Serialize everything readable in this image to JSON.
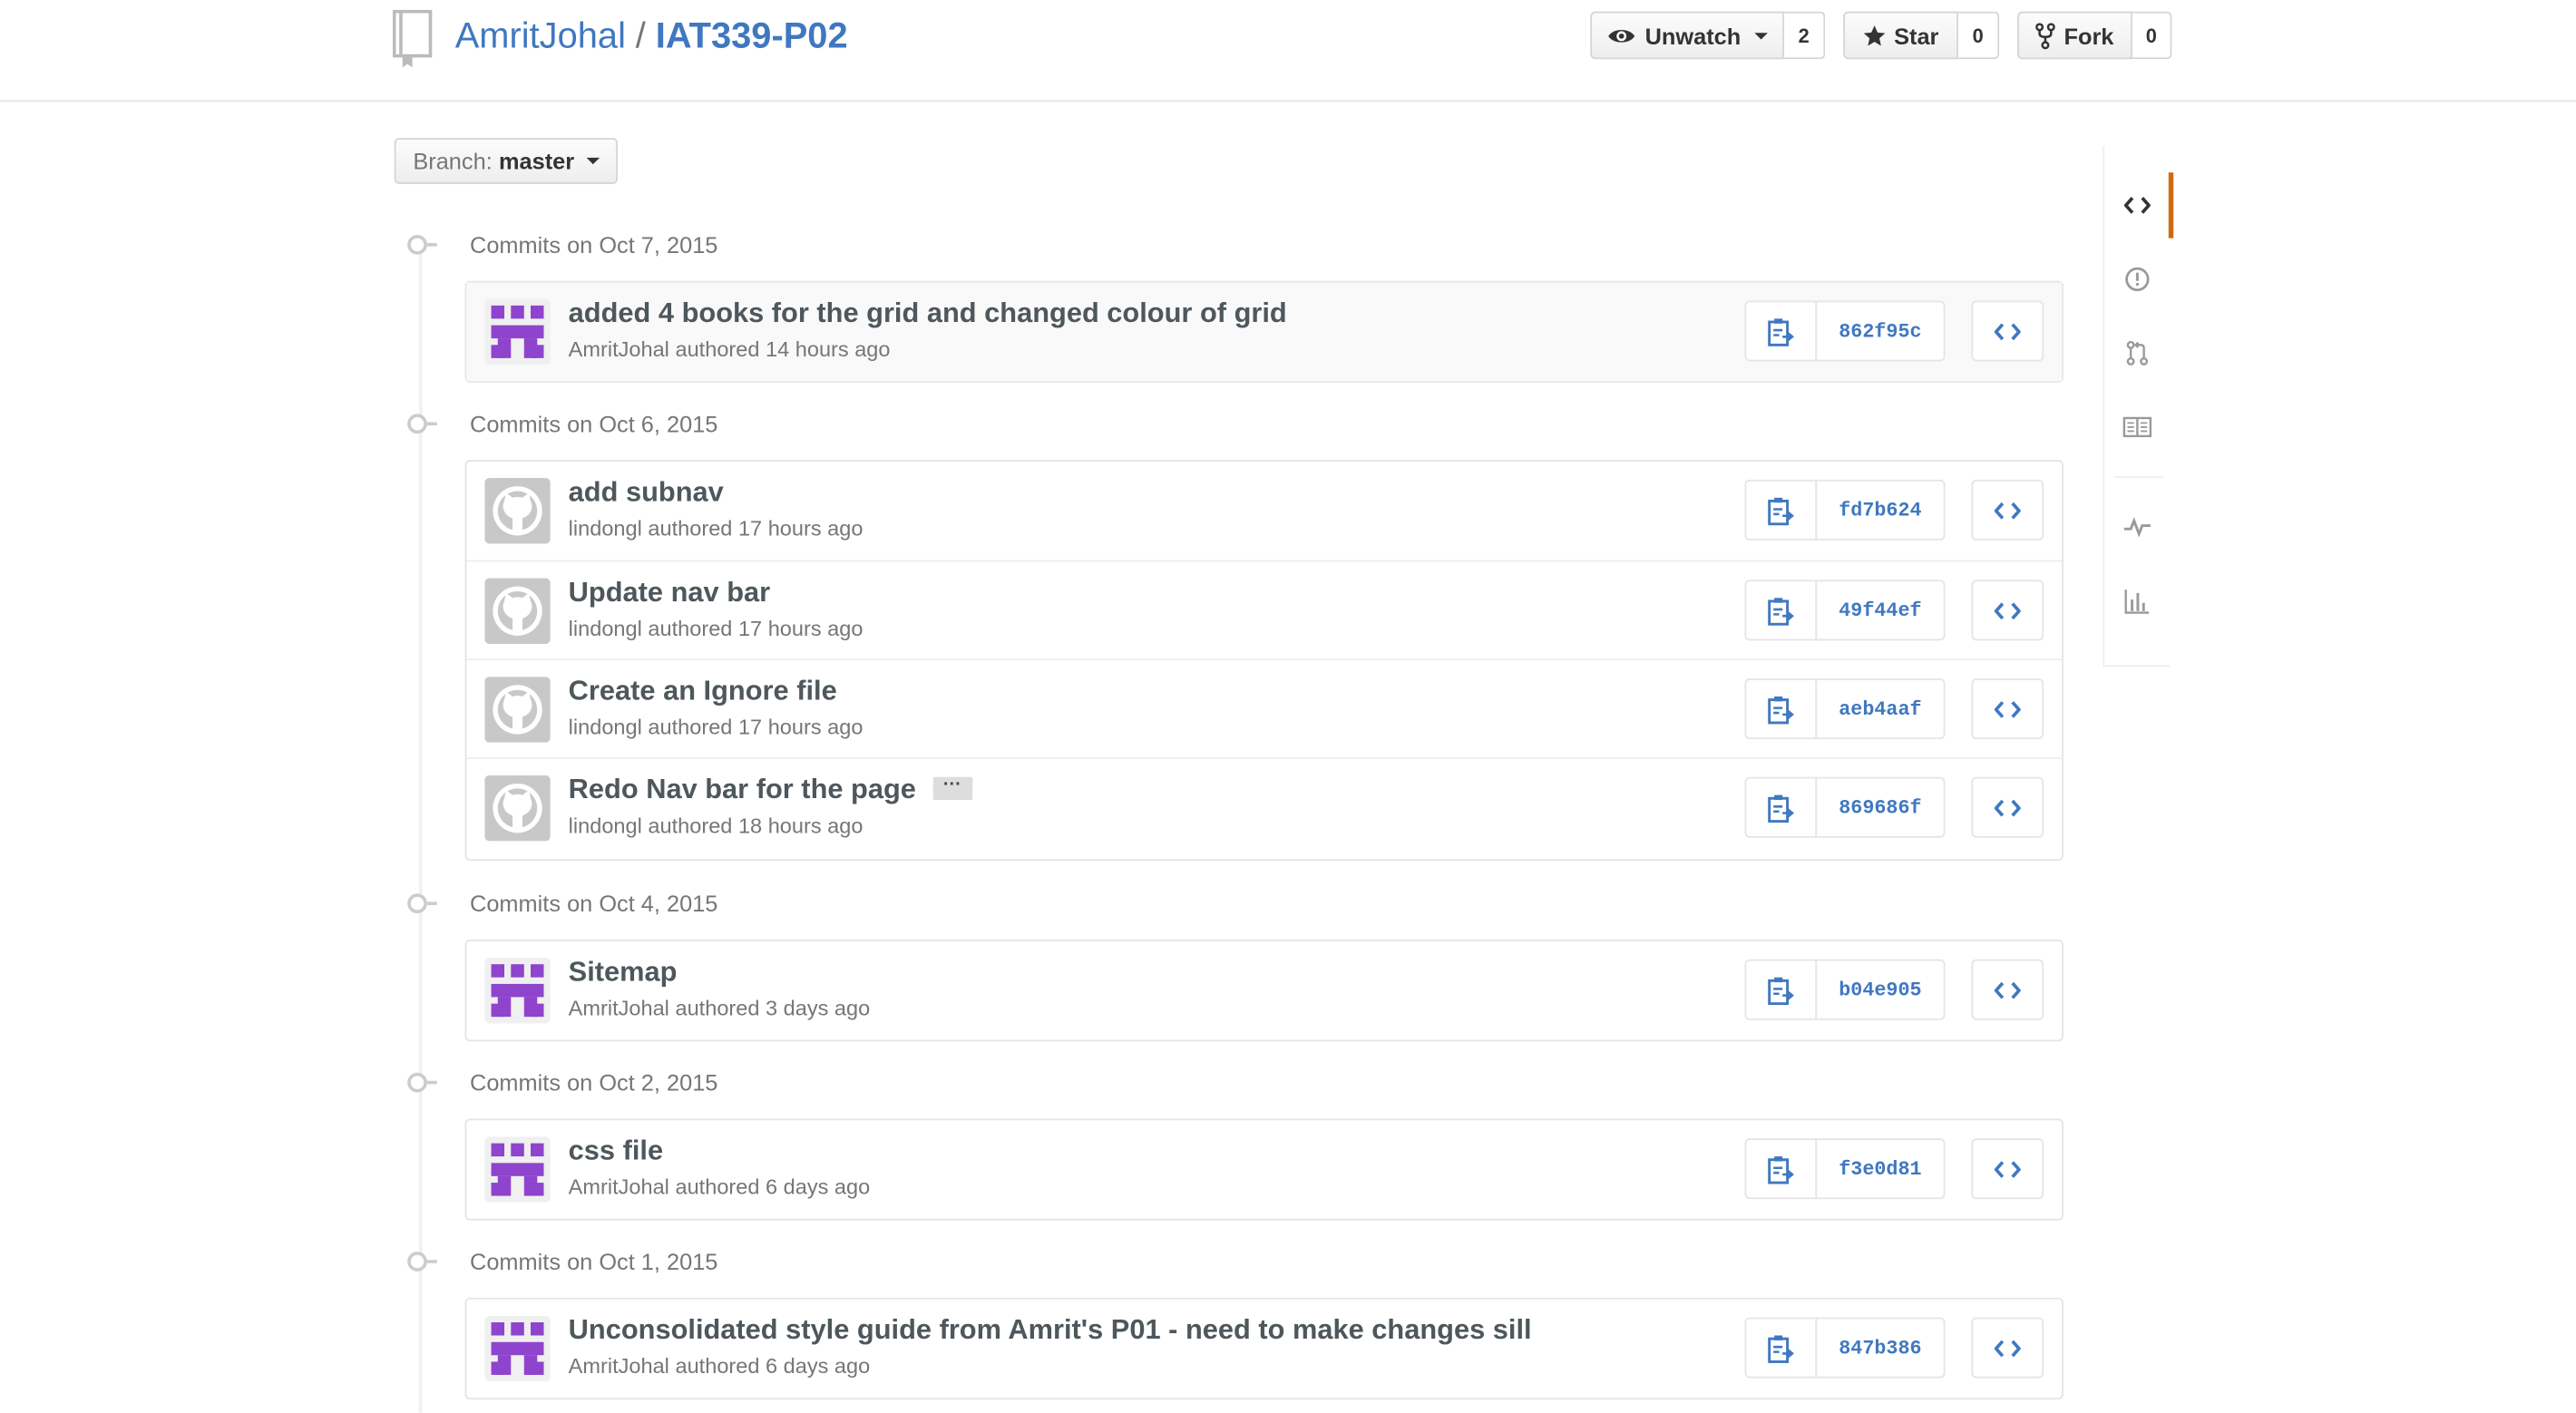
{
  "repo": {
    "owner": "AmritJohal",
    "separator": "/",
    "name": "IAT339-P02"
  },
  "actions": {
    "watch": {
      "label": "Unwatch",
      "count": "2"
    },
    "star": {
      "label": "Star",
      "count": "0"
    },
    "fork": {
      "label": "Fork",
      "count": "0"
    }
  },
  "branch": {
    "label": "Branch:",
    "value": "master"
  },
  "days": [
    {
      "date": "Commits on Oct 7, 2015",
      "commits": [
        {
          "message": "added 4 books for the grid and changed colour of grid",
          "author": "AmritJohal",
          "verb": "authored",
          "time": "14 hours ago",
          "sha": "862f95c",
          "avatar": "identicon-purple"
        }
      ]
    },
    {
      "date": "Commits on Oct 6, 2015",
      "commits": [
        {
          "message": "add subnav",
          "author": "lindongl",
          "verb": "authored",
          "time": "17 hours ago",
          "sha": "fd7b624",
          "avatar": "octocat-default"
        },
        {
          "message": "Update nav bar",
          "author": "lindongl",
          "verb": "authored",
          "time": "17 hours ago",
          "sha": "49f44ef",
          "avatar": "octocat-default"
        },
        {
          "message": "Create an Ignore file",
          "author": "lindongl",
          "verb": "authored",
          "time": "17 hours ago",
          "sha": "aeb4aaf",
          "avatar": "octocat-default"
        },
        {
          "message": "Redo Nav bar for the page",
          "author": "lindongl",
          "verb": "authored",
          "time": "18 hours ago",
          "sha": "869686f",
          "avatar": "octocat-default",
          "ellipsis": "···"
        }
      ]
    },
    {
      "date": "Commits on Oct 4, 2015",
      "commits": [
        {
          "message": "Sitemap",
          "author": "AmritJohal",
          "verb": "authored",
          "time": "3 days ago",
          "sha": "b04e905",
          "avatar": "identicon-purple"
        }
      ]
    },
    {
      "date": "Commits on Oct 2, 2015",
      "commits": [
        {
          "message": "css file",
          "author": "AmritJohal",
          "verb": "authored",
          "time": "6 days ago",
          "sha": "f3e0d81",
          "avatar": "identicon-purple"
        }
      ]
    },
    {
      "date": "Commits on Oct 1, 2015",
      "commits": [
        {
          "message": "Unconsolidated style guide from Amrit's P01 - need to make changes sill",
          "author": "AmritJohal",
          "verb": "authored",
          "time": "6 days ago",
          "sha": "847b386",
          "avatar": "identicon-purple"
        }
      ]
    }
  ],
  "sidenav": [
    {
      "name": "code-icon",
      "active": true
    },
    {
      "name": "issues-icon",
      "active": false
    },
    {
      "name": "pull-request-icon",
      "active": false
    },
    {
      "name": "wiki-icon",
      "active": false
    },
    {
      "name": "pulse-icon",
      "active": false
    },
    {
      "name": "graphs-icon",
      "active": false
    }
  ],
  "colors": {
    "link": "#4078c0",
    "active_tab": "#d26911",
    "identicon": "#8e44cc"
  }
}
